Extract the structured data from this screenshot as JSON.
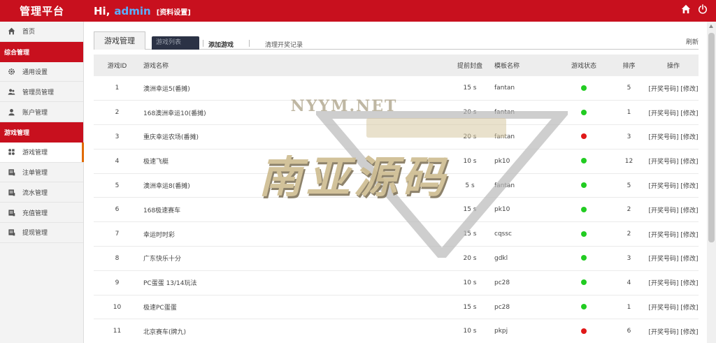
{
  "header": {
    "brand": "管理平台",
    "greeting": "Hi,",
    "username": "admin",
    "profile_link": "[资料设置]",
    "home_icon": "home-icon",
    "power_icon": "power-icon"
  },
  "sidebar": {
    "home": {
      "label": "首页",
      "icon": "home-icon"
    },
    "group1": "综合管理",
    "group1_items": [
      {
        "label": "通用设置",
        "icon": "gear-icon"
      },
      {
        "label": "管理员管理",
        "icon": "users-icon"
      },
      {
        "label": "账户管理",
        "icon": "user-icon"
      }
    ],
    "group2": "游戏管理",
    "group2_items": [
      {
        "label": "游戏管理",
        "icon": "apps-icon"
      },
      {
        "label": "注单管理",
        "icon": "document-icon"
      },
      {
        "label": "流水管理",
        "icon": "document-icon"
      },
      {
        "label": "充值管理",
        "icon": "document-icon"
      },
      {
        "label": "提现管理",
        "icon": "document-icon"
      }
    ]
  },
  "tabs": {
    "title": "游戏管理",
    "list": "游戏列表",
    "add": "添加游戏",
    "clear": "清理开奖记录",
    "refresh": "刷新"
  },
  "table": {
    "columns": [
      "游戏ID",
      "游戏名称",
      "提前封盘",
      "模板名称",
      "游戏状态",
      "排序",
      "操作"
    ],
    "rows": [
      {
        "id": "1",
        "name": "澳洲幸运5(番摊)",
        "close": "15 s",
        "template": "fantan",
        "status": "on",
        "sort": "5",
        "ops": "[开奖号码] [修改]"
      },
      {
        "id": "2",
        "name": "168澳洲幸运10(番摊)",
        "close": "20 s",
        "template": "fantan",
        "status": "on",
        "sort": "1",
        "ops": "[开奖号码] [修改]"
      },
      {
        "id": "3",
        "name": "重庆幸运农场(番摊)",
        "close": "20 s",
        "template": "fantan",
        "status": "off",
        "sort": "3",
        "ops": "[开奖号码] [修改]"
      },
      {
        "id": "4",
        "name": "极速飞艇",
        "close": "10 s",
        "template": "pk10",
        "status": "on",
        "sort": "12",
        "ops": "[开奖号码] [修改]"
      },
      {
        "id": "5",
        "name": "澳洲幸运8(番摊)",
        "close": "5 s",
        "template": "fantan",
        "status": "on",
        "sort": "5",
        "ops": "[开奖号码] [修改]"
      },
      {
        "id": "6",
        "name": "168极速赛车",
        "close": "15 s",
        "template": "pk10",
        "status": "on",
        "sort": "2",
        "ops": "[开奖号码] [修改]"
      },
      {
        "id": "7",
        "name": "幸运时时彩",
        "close": "15 s",
        "template": "cqssc",
        "status": "on",
        "sort": "2",
        "ops": "[开奖号码] [修改]"
      },
      {
        "id": "8",
        "name": "广东快乐十分",
        "close": "20 s",
        "template": "gdkl",
        "status": "on",
        "sort": "3",
        "ops": "[开奖号码] [修改]"
      },
      {
        "id": "9",
        "name": "PC蛋蛋 13/14玩法",
        "close": "10 s",
        "template": "pc28",
        "status": "on",
        "sort": "4",
        "ops": "[开奖号码] [修改]"
      },
      {
        "id": "10",
        "name": "极速PC蛋蛋",
        "close": "15 s",
        "template": "pc28",
        "status": "on",
        "sort": "1",
        "ops": "[开奖号码] [修改]"
      },
      {
        "id": "11",
        "name": "北京赛车(牌九)",
        "close": "10 s",
        "template": "pkpj",
        "status": "off",
        "sort": "6",
        "ops": "[开奖号码] [修改]"
      }
    ]
  },
  "colors": {
    "brand_red": "#c8101e",
    "status_on": "#22cc22",
    "status_off": "#e01818"
  },
  "watermark": {
    "top": "NYYM.NET",
    "main": "南亚源码"
  }
}
